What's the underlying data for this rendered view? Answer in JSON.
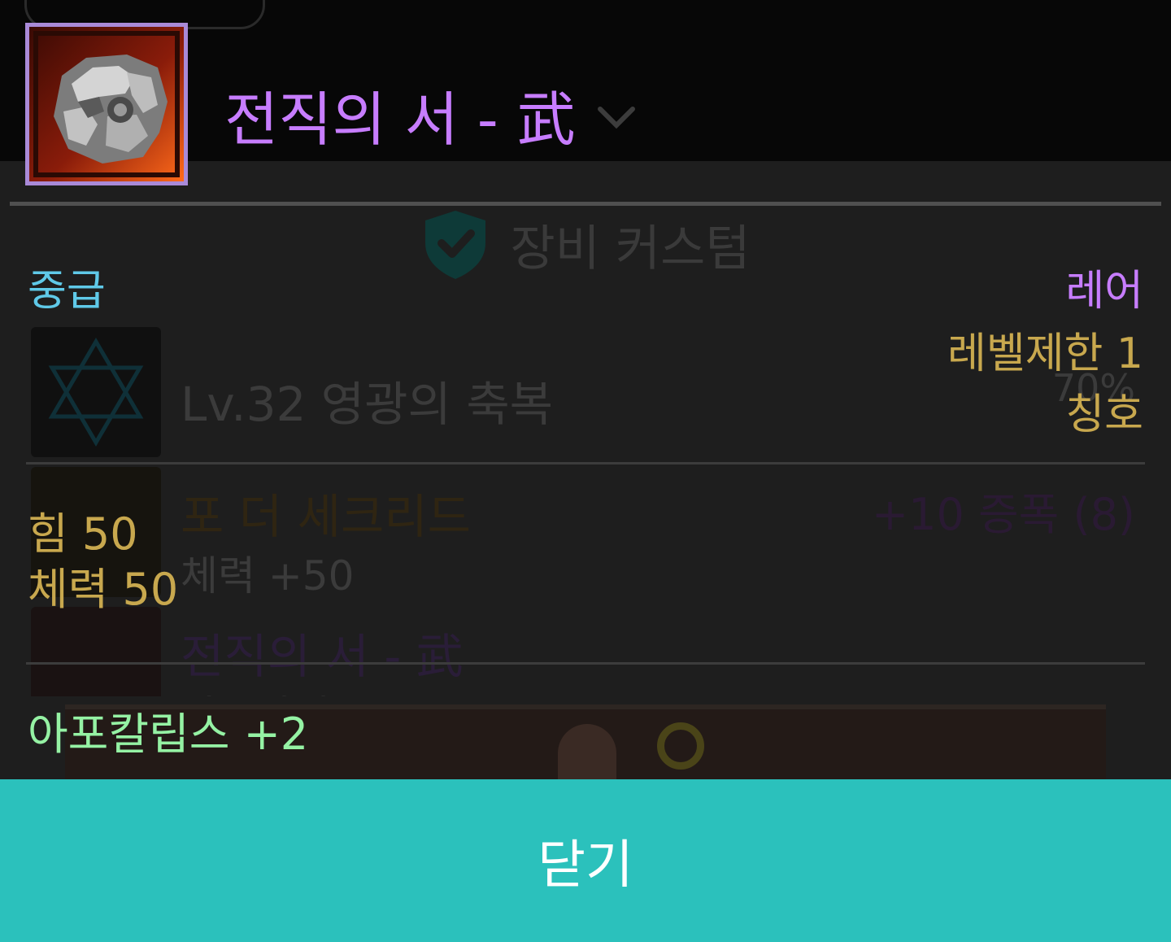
{
  "background": {
    "section_title": "장비 커스텀",
    "rows": [
      {
        "title": "Lv.32 영광의 축복",
        "right_text": "70%"
      },
      {
        "title": "포 더 세크리드",
        "right_text": "+10 증폭 (8)",
        "sub": "체력 +50"
      },
      {
        "title": "전직의 서 - 武",
        "sub": "아포칼립스 +2"
      }
    ]
  },
  "item": {
    "name": "전직의 서 - 武",
    "icon": "rock-item-icon",
    "grade": "중급",
    "rarity": "레어",
    "level_limit": "레벨제한 1",
    "category": "칭호",
    "stats": [
      "힘 50",
      "체력 50"
    ],
    "effect": "아포칼립스 +2"
  },
  "close_button": {
    "label": "닫기"
  },
  "colors": {
    "name": "#c77dff",
    "grade": "#5fc9e8",
    "level": "#c8a84e",
    "effect": "#95f2a4",
    "close_bg": "#2bc1bc"
  }
}
